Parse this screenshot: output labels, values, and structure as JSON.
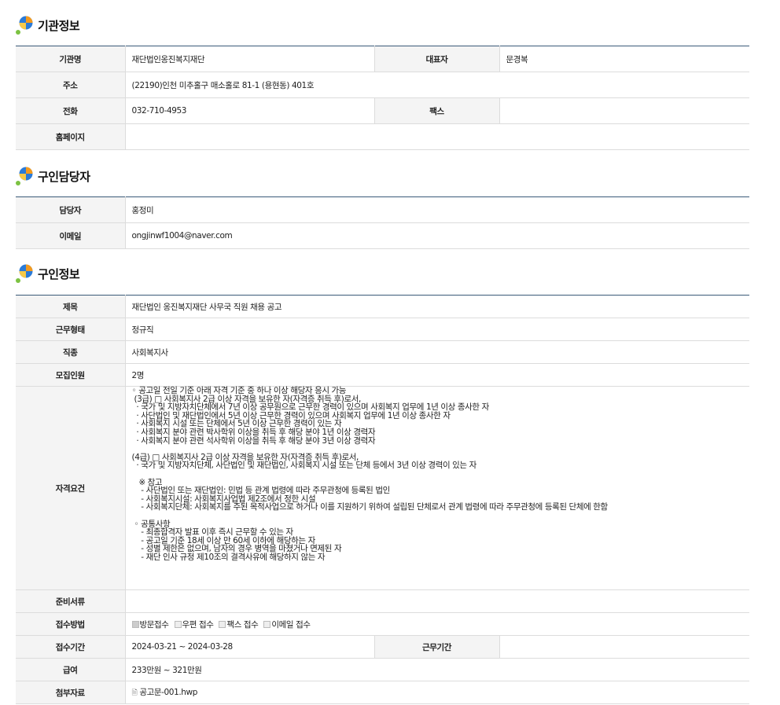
{
  "org": {
    "title": "기관정보",
    "rows": {
      "name_label": "기관명",
      "name_value": "재단법인옹진복지재단",
      "ceo_label": "대표자",
      "ceo_value": "문경복",
      "addr_label": "주소",
      "addr_value": "(22190)인천 미추홀구 매소홀로 81-1 (용현동) 401호",
      "tel_label": "전화",
      "tel_value": "032-710-4953",
      "fax_label": "팩스",
      "fax_value": "",
      "home_label": "홈페이지",
      "home_value": ""
    }
  },
  "contact": {
    "title": "구인담당자",
    "manager_label": "담당자",
    "manager_value": "홍정미",
    "email_label": "이메일",
    "email_value": "ongjinwf1004@naver.com"
  },
  "job": {
    "title": "구인정보",
    "subject_label": "제목",
    "subject_value": "재단법인 옹진복지재단 사무국 직원 채용 공고",
    "type_label": "근무형태",
    "type_value": "정규직",
    "occ_label": "직종",
    "occ_value": "사회복지사",
    "count_label": "모집인원",
    "count_value": "2명",
    "req_label": "자격요건",
    "req_value": "◦ 공고일 전일 기준 아래 자격 기준 중 하나 이상 해당자 응시 가능\n (3급) □ 사회복지사 2급 이상 자격을 보유한 자(자격증 취득 후)로서,\n  · 국가 및 지방자치단체에서 7년 이상 공무원으로 근무한 경력이 있으며 사회복지 업무에 1년 이상 종사한 자\n  · 사단법인 및 재단법인에서 5년 이상 근무한 경력이 있으며 사회복지 업무에 1년 이상 종사한 자\n  · 사회복지 시설 또는 단체에서 5년 이상 근무한 경력이 있는 자\n  · 사회복지 분야 관련 박사학위 이상을 취득 후 해당 분야 1년 이상 경력자\n  · 사회복지 분야 관련 석사학위 이상을 취득 후 해당 분야 3년 이상 경력자\n\n(4급) □ 사회복지사 2급 이상 자격을 보유한 자(자격증 취득 후)로서,\n  · 국가 및 지방자치단체, 사단법인 및 재단법인, 사회복지 시설 또는 단체 등에서 3년 이상 경력이 있는 자\n\n   ※ 참고\n    - 사단법인 또는 재단법인: 민법 등 관계 법령에 따라 주무관청에 등록된 법인\n    - 사회복지시설: 사회복지사업법 제2조에서 정한 시설\n    - 사회복지단체: 사회복지를 주된 목적사업으로 하거나 이를 지원하기 위하여 설립된 단체로서 관계 법령에 따라 주무관청에 등록된 단체에 한함\n\n ◦ 공통사항\n    - 최종합격자 발표 이후 즉시 근무할 수 있는 자\n    - 공고일 기준 18세 이상 만 60세 이하에 해당하는 자\n    - 성별 제한은 없으며, 남자의 경우 병역을 마쳤거나 면제된 자\n    - 재단 인사 규정 제10조의 결격사유에 해당하지 않는 자",
    "docs_label": "준비서류",
    "docs_value": "",
    "method_label": "접수방법",
    "methods": [
      "방문접수",
      "우편 접수",
      "팩스 접수",
      "이메일 접수"
    ],
    "period_label": "접수기간",
    "period_value": "2024-03-21 ~ 2024-03-28",
    "workperiod_label": "근무기간",
    "workperiod_value": "",
    "salary_label": "급여",
    "salary_value": "233만원 ~ 321만원",
    "attach_label": "첨부자료",
    "attach_value": "공고문-001.hwp"
  },
  "colors": {
    "header_line": "#3a5a78",
    "th_bg": "#f4f4f4",
    "border": "#dcdcdc",
    "logo_green": "#7cc242",
    "logo_blue": "#2b7bd8",
    "logo_orange": "#f39a1e"
  }
}
